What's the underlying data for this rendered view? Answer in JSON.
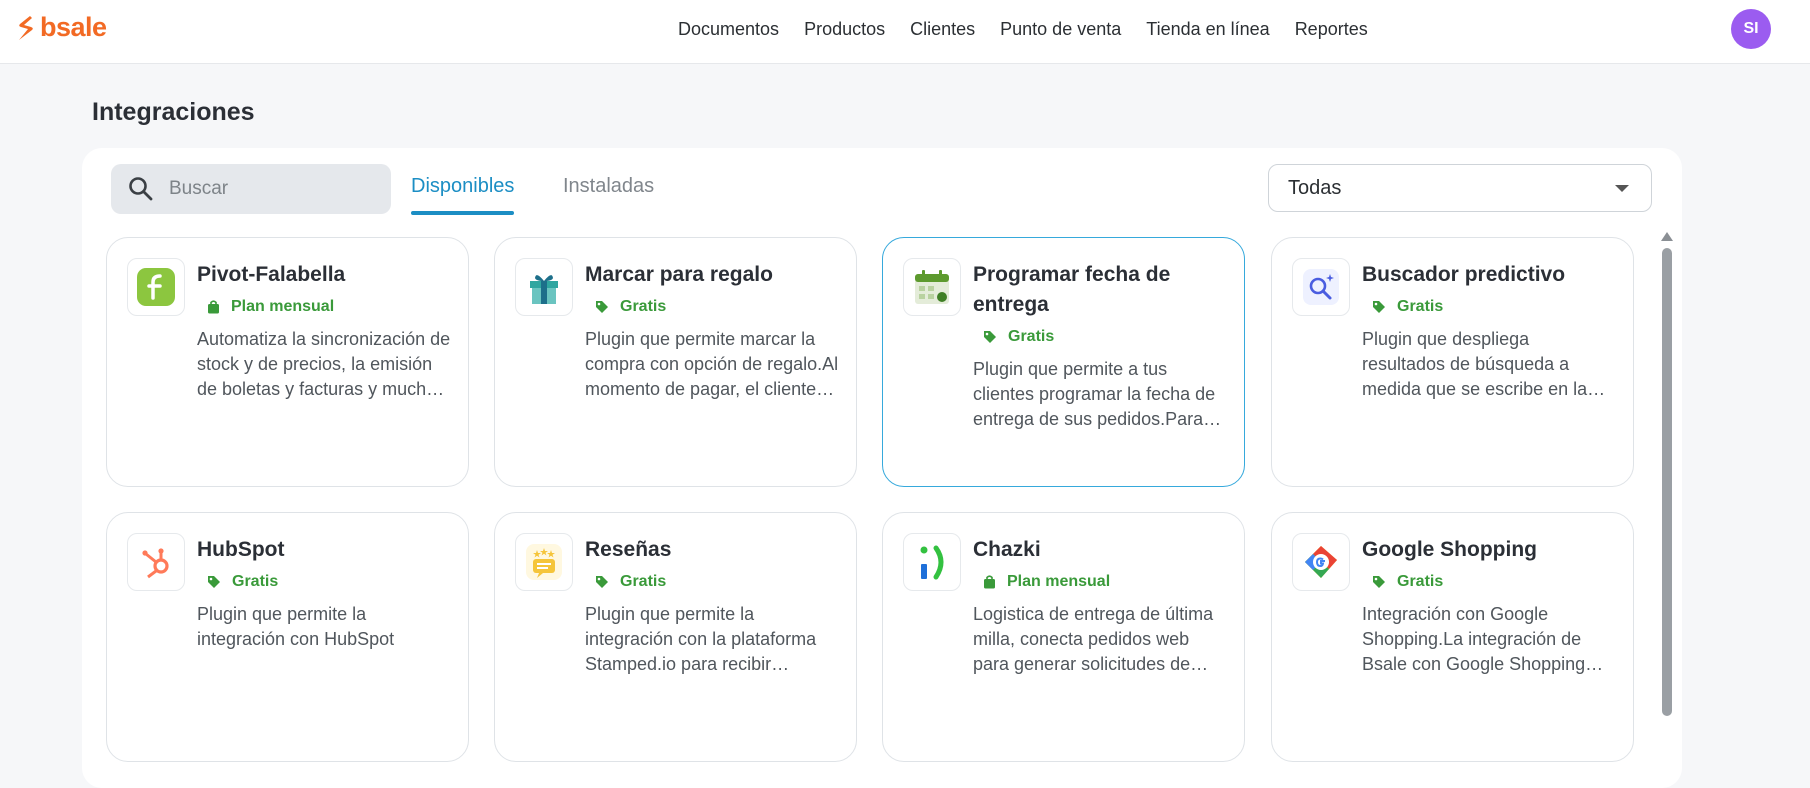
{
  "brand": {
    "name": "bsale",
    "color": "#f26a24"
  },
  "nav": {
    "items": [
      "Documentos",
      "Productos",
      "Clientes",
      "Punto de venta",
      "Tienda en línea",
      "Reportes"
    ]
  },
  "user": {
    "initials": "SI",
    "avatar_color": "#9b5cf0"
  },
  "page": {
    "title": "Integraciones"
  },
  "search": {
    "placeholder": "Buscar",
    "value": ""
  },
  "tabs": {
    "available": "Disponibles",
    "installed": "Instaladas",
    "active": "available"
  },
  "filter": {
    "selected": "Todas"
  },
  "colors": {
    "accent": "#1c8ec4",
    "plan_text": "#3a9a3a"
  },
  "cards": [
    {
      "title": "Pivot-Falabella",
      "plan": "Plan mensual",
      "plan_icon": "bag-icon",
      "logo": "pivot-falabella-logo",
      "desc": "Automatiza la sincronización de stock y de precios, la emisión de boletas y facturas y mucho más."
    },
    {
      "title": "Marcar para regalo",
      "plan": "Gratis",
      "plan_icon": "tag-icon",
      "logo": "gift-icon",
      "desc": "Plugin que permite marcar la compra con opción de regalo.Al momento de pagar, el cliente puede indicar un mensaje."
    },
    {
      "title": "Programar fecha de entrega",
      "plan": "Gratis",
      "plan_icon": "tag-icon",
      "logo": "calendar-icon",
      "desc": "Plugin que permite a tus clientes programar la fecha de entrega de sus pedidos.Para que los reciban cuando quieran.",
      "selected": true
    },
    {
      "title": "Buscador predictivo",
      "plan": "Gratis",
      "plan_icon": "tag-icon",
      "logo": "search-sparkle-icon",
      "desc": "Plugin que despliega resultados de búsqueda a medida que se escribe en la barra de búsqueda."
    },
    {
      "title": "HubSpot",
      "plan": "Gratis",
      "plan_icon": "tag-icon",
      "logo": "hubspot-logo",
      "desc": "Plugin que permite la integración con HubSpot"
    },
    {
      "title": "Reseñas",
      "plan": "Gratis",
      "plan_icon": "tag-icon",
      "logo": "reviews-icon",
      "desc": "Plugin que permite la integración con la plataforma Stamped.io para recibir reseñas de tus productos."
    },
    {
      "title": "Chazki",
      "plan": "Plan mensual",
      "plan_icon": "bag-icon",
      "logo": "chazki-logo",
      "desc": "Logistica de entrega de última milla, conecta pedidos web para generar solicitudes de envío automáticamente."
    },
    {
      "title": "Google Shopping",
      "plan": "Gratis",
      "plan_icon": "tag-icon",
      "logo": "google-shopping-logo",
      "desc": "Integración con Google Shopping.La integración de Bsale con Google Shopping permite publicar tus productos."
    }
  ]
}
